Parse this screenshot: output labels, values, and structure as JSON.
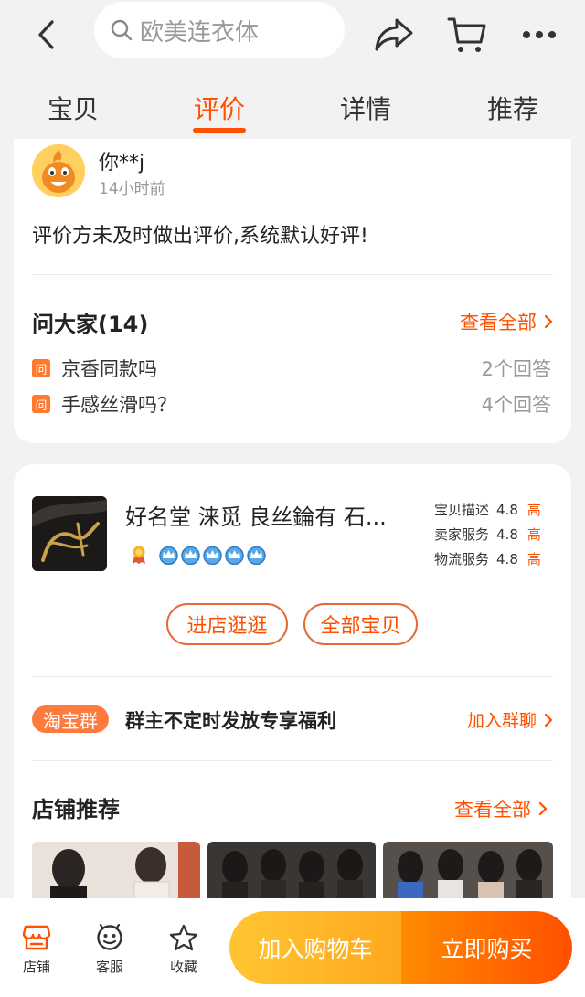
{
  "search": {
    "placeholder": "欧美连衣体"
  },
  "tabs": [
    {
      "label": "宝贝"
    },
    {
      "label": "评价"
    },
    {
      "label": "详情"
    },
    {
      "label": "推荐"
    }
  ],
  "review": {
    "user": "你**j",
    "time": "14小时前",
    "text": "评价方未及时做出评价,系统默认好评!"
  },
  "ask": {
    "title": "问大家(14)",
    "view_all": "查看全部",
    "badge": "问",
    "questions": [
      {
        "text": "京香同款吗",
        "answers": "2个回答"
      },
      {
        "text": "手感丝滑吗？",
        "answers": "4个回答"
      }
    ]
  },
  "shop": {
    "name": "好名堂 涞觅 良丝錀有 石...",
    "crowns": 5,
    "scores": [
      {
        "label": "宝贝描述",
        "value": "4.8",
        "level": "高"
      },
      {
        "label": "卖家服务",
        "value": "4.8",
        "level": "高"
      },
      {
        "label": "物流服务",
        "value": "4.8",
        "level": "高"
      }
    ],
    "visit_button": "进店逛逛",
    "all_items_button": "全部宝贝",
    "group_badge": "淘宝群",
    "group_text": "群主不定时发放专享福利",
    "group_join": "加入群聊",
    "recommend_title": "店铺推荐",
    "recommend_all": "查看全部"
  },
  "bottom": {
    "store": "店铺",
    "service": "客服",
    "favorite": "收藏",
    "add_cart": "加入购物车",
    "buy_now": "立即购买"
  },
  "colors": {
    "accent": "#ff5000",
    "cart_gradient": "#ffb31f",
    "buy_gradient": "#ff6a00"
  }
}
